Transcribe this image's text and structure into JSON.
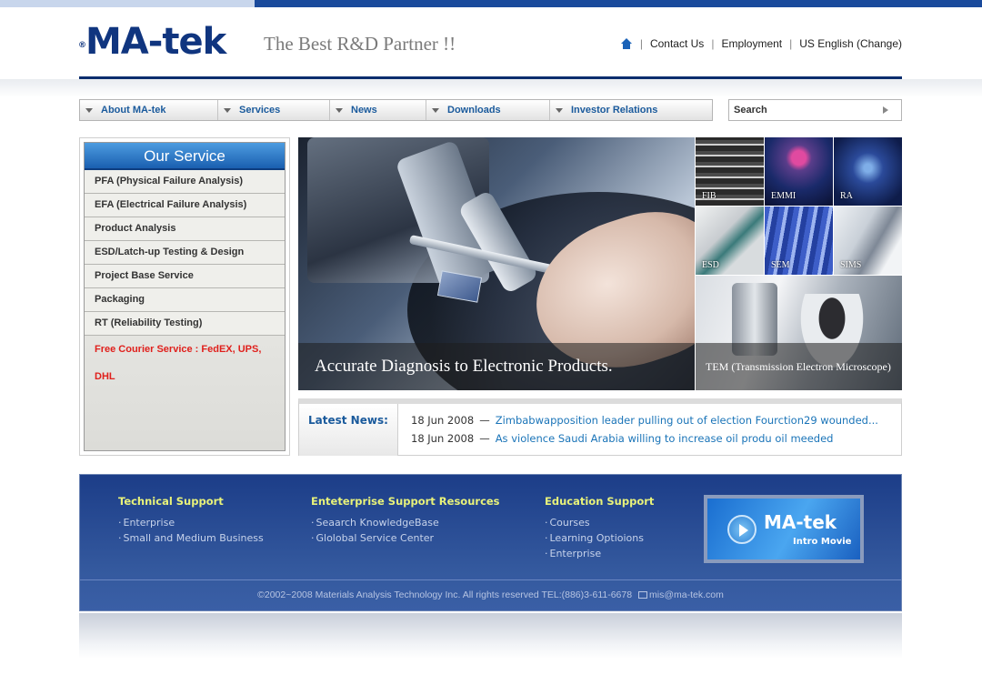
{
  "header": {
    "logo_text": "MA-tek",
    "logo_reg": "®",
    "tagline": "The Best R&D Partner !!",
    "util_links": [
      "Contact Us",
      "Employment",
      "US English (Change)"
    ]
  },
  "nav": {
    "items": [
      "About MA-tek",
      "Services",
      "News",
      "Downloads",
      "Investor Relations"
    ]
  },
  "search": {
    "placeholder": "Search"
  },
  "sidebar": {
    "title": "Our Service",
    "items": [
      "PFA (Physical Failure Analysis)",
      "EFA (Electrical Failure Analysis)",
      "Product Analysis",
      "ESD/Latch-up Testing & Design",
      "Project Base Service",
      "Packaging",
      "RT (Reliability Testing)"
    ],
    "courier": "Free Courier Service : FedEX, UPS, DHL"
  },
  "hero": {
    "caption": "Accurate Diagnosis to Electronic Products."
  },
  "tiles": [
    "FIB",
    "EMMI",
    "RA",
    "ESD",
    "SEM",
    "SIMS"
  ],
  "tem": {
    "caption": "TEM (Transmission Electron Microscope)"
  },
  "news": {
    "label": "Latest News:",
    "items": [
      {
        "date": "18 Jun 2008",
        "title": "Zimbabwapposition leader pulling out of election Fourction29 wounded..."
      },
      {
        "date": "18 Jun 2008",
        "title": "As violence Saudi Arabia willing to increase oil produ oil meeded"
      }
    ]
  },
  "footer": {
    "columns": [
      {
        "title": "Technical Support",
        "links": [
          "Enterprise",
          "Small and Medium Business"
        ]
      },
      {
        "title": "Enteterprise Support Resources",
        "links": [
          "Seaarch KnowledgeBase",
          "Glolobal Service Center"
        ]
      },
      {
        "title": "Education Support",
        "links": [
          "Courses",
          "Learning Optioions",
          "Enterprise"
        ]
      }
    ],
    "movie": {
      "logo": "MA-tek",
      "label": "Intro Movie"
    },
    "copyright": "©2002~2008 Materials Analysis Technology Inc. All rights reserved  TEL:(886)3-611-6678",
    "email": "mis@ma-tek.com"
  },
  "colors": {
    "brand_navy": "#10357f",
    "nav_text": "#1a5a9c",
    "link_blue": "#1a74b8",
    "courier_red": "#e0201c",
    "footer_heading": "#e8f27a"
  }
}
